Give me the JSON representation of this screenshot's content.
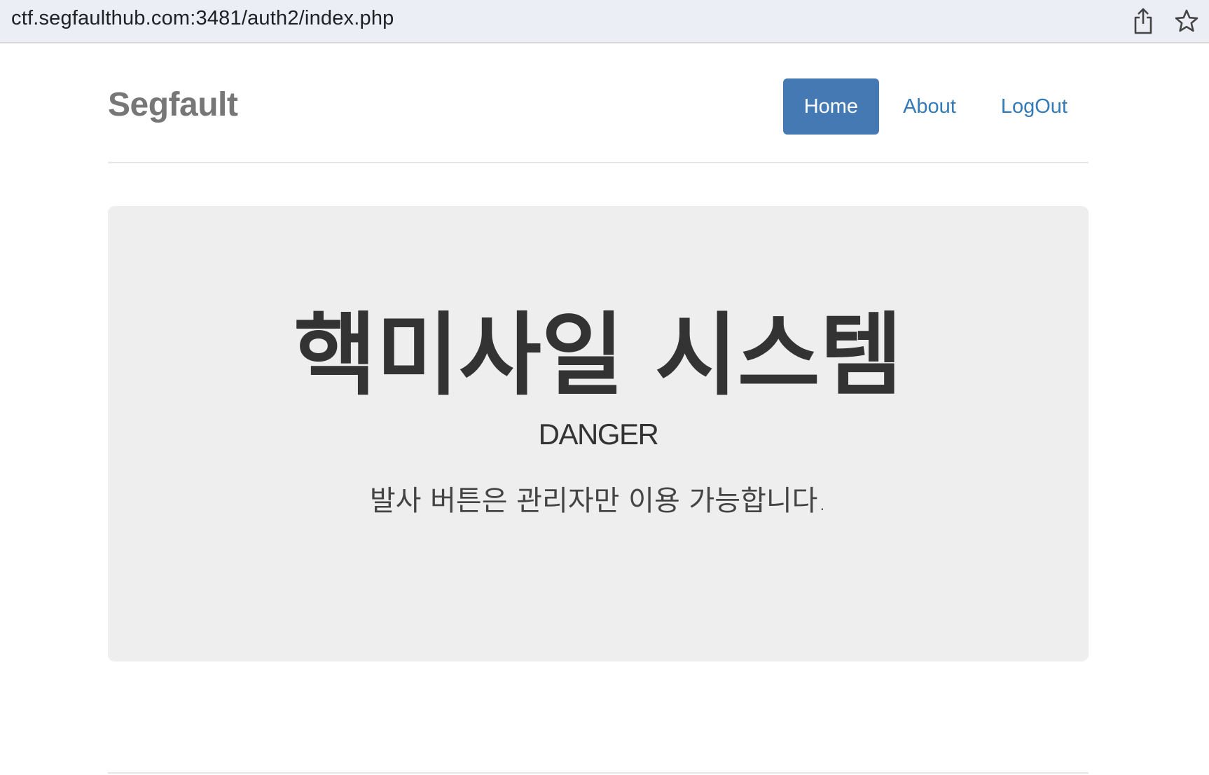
{
  "browser": {
    "url": "ctf.segfaulthub.com:3481/auth2/index.php",
    "icons": [
      "share-icon",
      "bookmark-star-icon"
    ]
  },
  "header": {
    "brand": "Segfault",
    "nav": [
      {
        "label": "Home",
        "active": true
      },
      {
        "label": "About",
        "active": false
      },
      {
        "label": "LogOut",
        "active": false
      }
    ]
  },
  "jumbotron": {
    "title": "핵미사일 시스템",
    "subtitle": "DANGER",
    "text": "발사 버튼은 관리자만 이용 가능합니다."
  },
  "colors": {
    "nav_active_bg": "#4479b4",
    "link": "#337ab7",
    "jumbotron_bg": "#eeeeee",
    "brand": "#777777"
  }
}
